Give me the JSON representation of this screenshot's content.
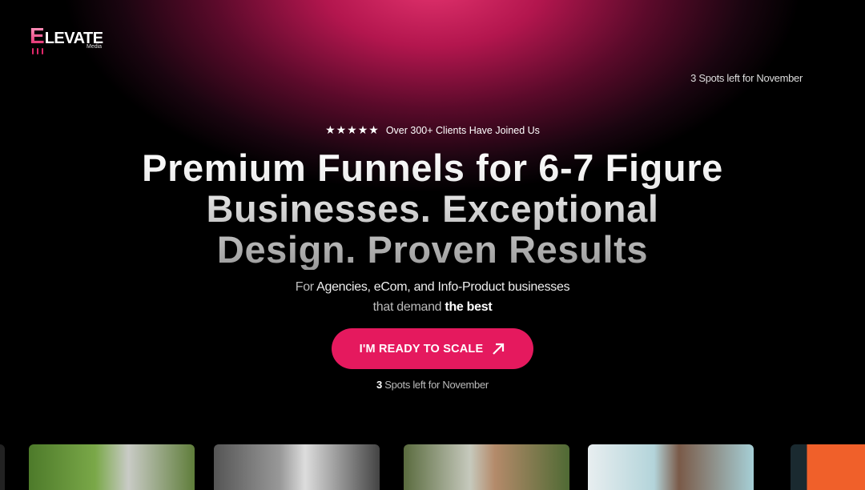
{
  "brand": {
    "logo_letter": "E",
    "logo_rest": "LEVATE",
    "logo_sub": "Media"
  },
  "header": {
    "spots": "3 Spots left for November"
  },
  "hero": {
    "rating_stars": 5,
    "social_proof": "Over 300+ Clients Have Joined Us",
    "title_lines": [
      "Premium Funnels for 6-7 Figure",
      "Businesses. Exceptional",
      "Design. Proven Results"
    ],
    "subtitle": {
      "prefix": "For ",
      "highlight": "Agencies, eCom, and Info-Product businesses",
      "line2_prefix": "that demand ",
      "line2_bold": "the best"
    },
    "cta_label": "I'M READY TO SCALE",
    "spots_count": "3",
    "spots_text": " Spots left for November"
  },
  "gallery": {
    "cards": [
      "client-photo-1",
      "client-photo-2",
      "client-photo-3",
      "client-photo-4",
      "client-photo-5"
    ]
  },
  "colors": {
    "accent": "#e5195e",
    "background": "#000000"
  }
}
